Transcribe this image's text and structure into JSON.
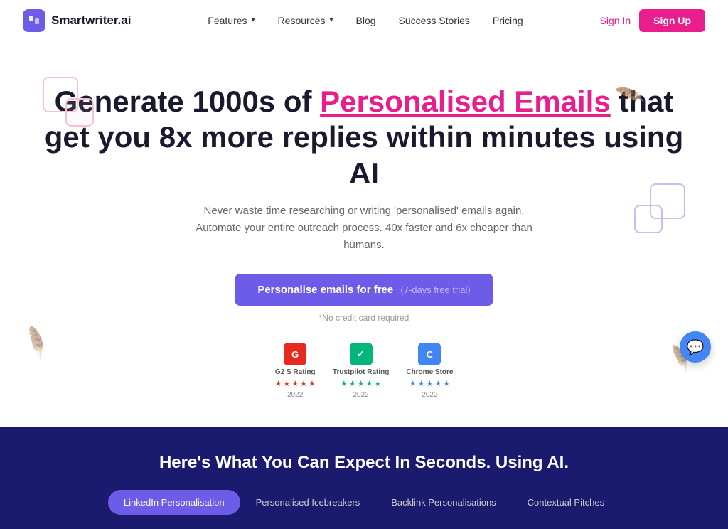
{
  "brand": {
    "name": "Smartwriter.ai"
  },
  "nav": {
    "links": [
      {
        "id": "features",
        "label": "Features",
        "hasDropdown": true
      },
      {
        "id": "resources",
        "label": "Resources",
        "hasDropdown": true
      },
      {
        "id": "blog",
        "label": "Blog",
        "hasDropdown": false
      },
      {
        "id": "success-stories",
        "label": "Success Stories",
        "hasDropdown": false
      },
      {
        "id": "pricing",
        "label": "Pricing",
        "hasDropdown": false
      }
    ],
    "signin_label": "Sign In",
    "signup_label": "Sign Up"
  },
  "hero": {
    "title_part1": "Generate 1000s of ",
    "title_highlight": "Personalised Emails",
    "title_part2": " that get you 8x more replies within minutes using AI",
    "subtitle": "Never waste time researching or writing 'personalised' emails again. Automate your entire outreach process. 40x faster and 6x cheaper than humans.",
    "cta_label": "Personalise emails for free",
    "cta_sub": "(7-days free trial)",
    "no_credit_card": "*No credit card required",
    "ratings": [
      {
        "id": "g2",
        "name": "G2 S Rating",
        "year": "2022",
        "type": "g2",
        "letter": "G"
      },
      {
        "id": "tp",
        "name": "Trustpilot Rating",
        "year": "2022",
        "type": "tp",
        "letter": "✓"
      },
      {
        "id": "cs",
        "name": "Chrome Store",
        "year": "2022",
        "type": "cs",
        "letter": "C"
      }
    ]
  },
  "bottom": {
    "title": "Here's What You Can Expect In Seconds. Using AI.",
    "tabs": [
      {
        "id": "linkedin",
        "label": "LinkedIn Personalisation",
        "active": true
      },
      {
        "id": "icebreakers",
        "label": "Personalised Icebreakers",
        "active": false
      },
      {
        "id": "backlink",
        "label": "Backlink Personalisations",
        "active": false
      },
      {
        "id": "contextual",
        "label": "Contextual Pitches",
        "active": false
      }
    ]
  },
  "chat": {
    "icon": "💬"
  }
}
